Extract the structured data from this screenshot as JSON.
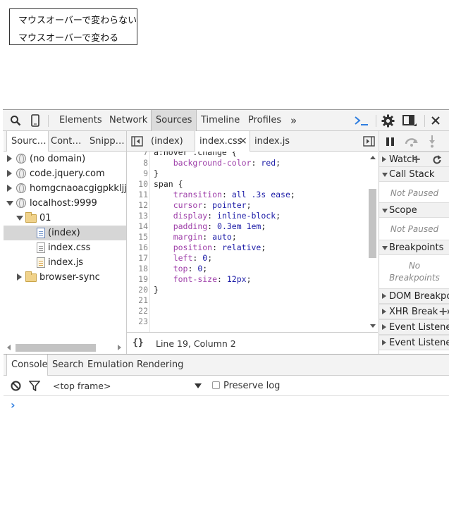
{
  "page": {
    "hover_no_change": "マウスオーバーで変わらない",
    "hover_change": "マウスオーバーで変わる"
  },
  "toolbar": {
    "tabs": [
      "Elements",
      "Network",
      "Sources",
      "Timeline",
      "Profiles"
    ],
    "active_tab": "Sources",
    "more": "»",
    "icons": [
      "search-icon",
      "device-mode-icon",
      "console-drawer-icon",
      "settings-icon",
      "dock-icon",
      "close-icon"
    ]
  },
  "navigator": {
    "tabs": [
      "Sourc…",
      "Cont…",
      "Snipp…"
    ],
    "tree": [
      {
        "label": "(no domain)",
        "type": "domain"
      },
      {
        "label": "code.jquery.com",
        "type": "domain"
      },
      {
        "label": "homgcnaoacgigpkkljjjel",
        "type": "domain"
      },
      {
        "label": "localhost:9999",
        "type": "domain"
      },
      {
        "label": "01",
        "type": "folder"
      },
      {
        "label": "(index)",
        "type": "file",
        "selected": true
      },
      {
        "label": "index.css",
        "type": "file"
      },
      {
        "label": "index.js",
        "type": "file"
      },
      {
        "label": "browser-sync",
        "type": "folder"
      }
    ]
  },
  "editor": {
    "tabs": [
      "(index)",
      "index.css",
      "index.js"
    ],
    "active_tab": "index.css",
    "close": "×",
    "lines": [
      {
        "n": "7",
        "t": "a:hover .change {"
      },
      {
        "n": "8",
        "t": "    background-color: red;"
      },
      {
        "n": "9",
        "t": "}"
      },
      {
        "n": "10",
        "t": "span {"
      },
      {
        "n": "11",
        "t": "    transition: all .3s ease;"
      },
      {
        "n": "12",
        "t": "    cursor: pointer;"
      },
      {
        "n": "13",
        "t": "    display: inline-block;"
      },
      {
        "n": "14",
        "t": "    padding: 0.3em 1em;"
      },
      {
        "n": "15",
        "t": "    margin: auto;"
      },
      {
        "n": "16",
        "t": "    position: relative;"
      },
      {
        "n": "17",
        "t": "    left: 0;"
      },
      {
        "n": "18",
        "t": "    top: 0;"
      },
      {
        "n": "19",
        "t": "    font-size: 12px;"
      },
      {
        "n": "20",
        "t": "}"
      },
      {
        "n": "21",
        "t": ""
      },
      {
        "n": "22",
        "t": ""
      },
      {
        "n": "23",
        "t": ""
      }
    ],
    "format_icon": "{}",
    "cursor_position": "Line 19, Column 2"
  },
  "debugger": {
    "watch": "Watch",
    "call_stack": "Call Stack",
    "not_paused_1": "Not Paused",
    "scope": "Scope",
    "not_paused_2": "Not Paused",
    "breakpoints": "Breakpoints",
    "no_bp_1": "No",
    "no_bp_2": "Breakpoints",
    "dom_bp": "DOM Breakpoints",
    "xhr_bp": "XHR Breakpoints",
    "event_bp": "Event Listener Breakpoints",
    "event_listeners": "Event Listeners"
  },
  "drawer": {
    "tabs": [
      "Console",
      "Search",
      "Emulation",
      "Rendering"
    ],
    "active_tab": "Console",
    "frame": "<top frame>",
    "preserve_log": "Preserve log",
    "prompt": "›"
  },
  "colors": {
    "css_property": "#9e3fa9",
    "css_value": "#1a1aa6",
    "prompt": "#2f7ee0"
  }
}
